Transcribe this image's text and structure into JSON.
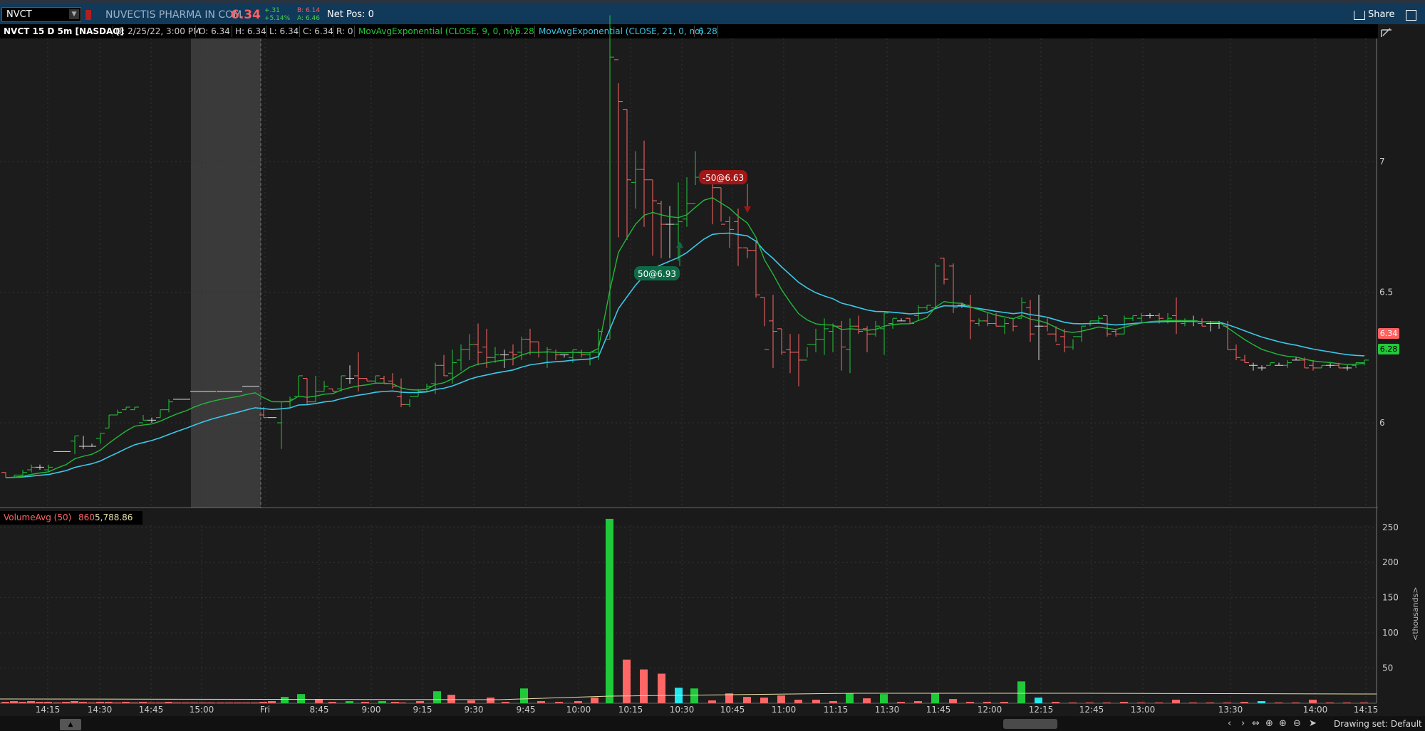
{
  "toolbar": {
    "symbol": "NVCT",
    "company": "NUVECTIS PHARMA IN COM",
    "last": "6.34",
    "change": "+.31",
    "change_pct": "+5.14%",
    "bid": "B: 6.14",
    "ask": "A: 6.46",
    "net_pos": "Net Pos: 0",
    "share": "Share"
  },
  "chart_header": {
    "title": "NVCT 15 D 5m [NASDAQ]",
    "date": "D: 2/25/22, 3:00 PM",
    "open": "O: 6.34",
    "high": "H: 6.34",
    "low": "L: 6.34",
    "close": "C: 6.34",
    "range": "R: 0",
    "ema9_label": "MovAvgExponential (CLOSE, 9, 0, no)",
    "ema9_value": "6.28",
    "ema21_label": "MovAvgExponential (CLOSE, 21, 0, no)",
    "ema21_value": "6.28"
  },
  "volume_header": {
    "label": "VolumeAvg (50)",
    "value": "860",
    "avg": "5,788.86"
  },
  "colors": {
    "up": "#1fc93a",
    "down": "#ff6666",
    "ema9": "#22b83a",
    "ema21": "#3bc8e8",
    "buy_tag": "#0e6a46",
    "sell_tag": "#a21616"
  },
  "price_axis": {
    "ticks": [
      "7",
      "6.5",
      "6"
    ],
    "last_tag": "6.34",
    "ema_tag": "6.28"
  },
  "volume_axis": {
    "ticks": [
      "250",
      "200",
      "150",
      "100",
      "50"
    ],
    "unit_label": "<thousands>"
  },
  "time_axis": [
    "14:15",
    "14:30",
    "14:45",
    "15:00",
    "Fri",
    "8:45",
    "9:00",
    "9:15",
    "9:30",
    "9:45",
    "10:00",
    "10:15",
    "10:30",
    "10:45",
    "11:00",
    "11:15",
    "11:30",
    "11:45",
    "12:00",
    "12:15",
    "12:45",
    "13:00",
    "13:30",
    "14:00",
    "14:15"
  ],
  "trades": [
    {
      "label": "50@6.93",
      "side": "buy"
    },
    {
      "label": "-50@6.63",
      "side": "sell"
    }
  ],
  "footer": {
    "drawing_set": "Drawing set: Default"
  }
}
